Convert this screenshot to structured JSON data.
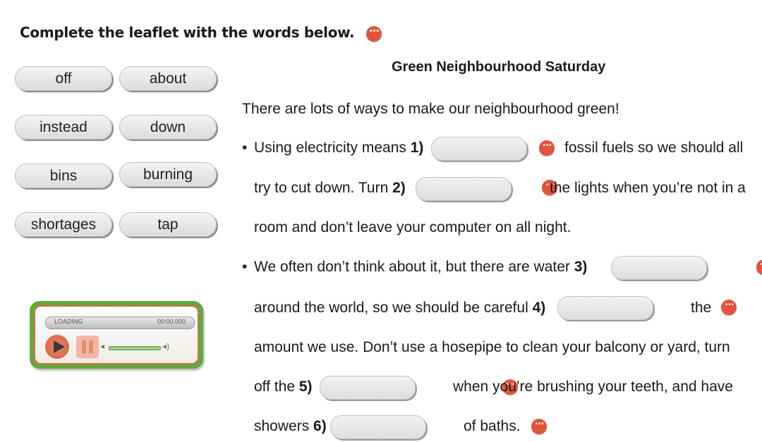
{
  "instruction": "Complete the leaflet with the words below.",
  "word_bank": [
    "off",
    "about",
    "instead",
    "down",
    "bins",
    "burning",
    "shortages",
    "tap"
  ],
  "leaflet": {
    "title": "Green Neighbourhood Saturday",
    "intro": "There are lots of ways to make our neighbourhood green!",
    "bullet": "•",
    "p1_a": "Using electricity means",
    "n1": "1)",
    "p1_b": "fossil fuels so we should all",
    "p1_c": "try to cut down. Turn",
    "n2": "2)",
    "p1_d": "the lights when you’re not in a",
    "p1_e": "room and don’t leave your computer on all night.",
    "p2_a": "We often don’t think about it, but there are water",
    "n3": "3)",
    "p2_b": "around the world, so we should be careful",
    "n4": "4)",
    "p2_c": "the",
    "p2_d": "amount we use. Don’t use a hosepipe to clean your balcony or yard, turn",
    "p2_e": "off the",
    "n5": "5)",
    "p2_f": "when you’re brushing your teeth, and have",
    "p2_g": "showers",
    "n6": "6)",
    "p2_h": "of baths."
  },
  "player": {
    "status": "LOADING",
    "time": "00:00.000",
    "progress": 0.0
  },
  "colors": {
    "hint": "#e4533a",
    "player_frame": "#5faa3b",
    "player_border": "#e06a4a"
  }
}
